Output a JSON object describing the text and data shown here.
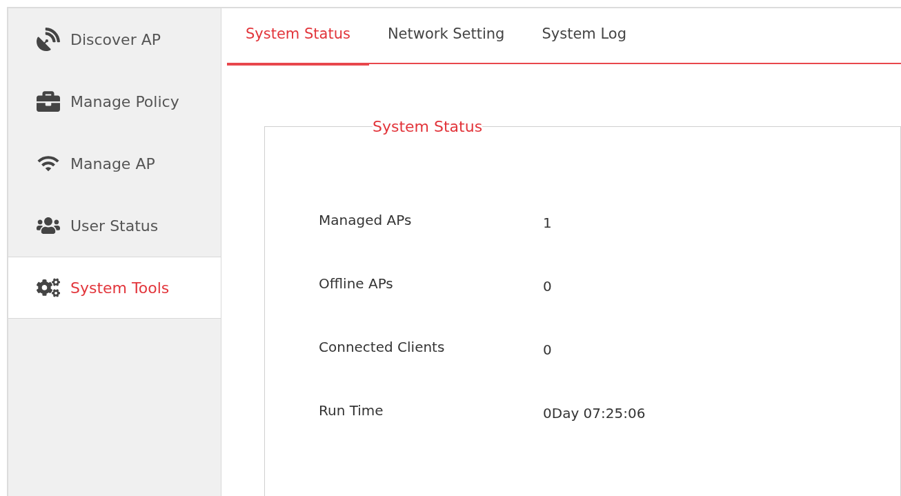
{
  "sidebar": {
    "items": [
      {
        "label": "Discover AP",
        "selected": false
      },
      {
        "label": "Manage Policy",
        "selected": false
      },
      {
        "label": "Manage AP",
        "selected": false
      },
      {
        "label": "User Status",
        "selected": false
      },
      {
        "label": "System Tools",
        "selected": true
      }
    ]
  },
  "tabs": [
    {
      "label": "System Status",
      "selected": true
    },
    {
      "label": "Network Setting",
      "selected": false
    },
    {
      "label": "System Log",
      "selected": false
    }
  ],
  "panel": {
    "title": "System Status",
    "rows": [
      {
        "label": "Managed APs",
        "value": "1"
      },
      {
        "label": "Offline APs",
        "value": "0"
      },
      {
        "label": "Connected Clients",
        "value": "0"
      },
      {
        "label": "Run Time",
        "value": "0Day 07:25:06"
      }
    ]
  }
}
